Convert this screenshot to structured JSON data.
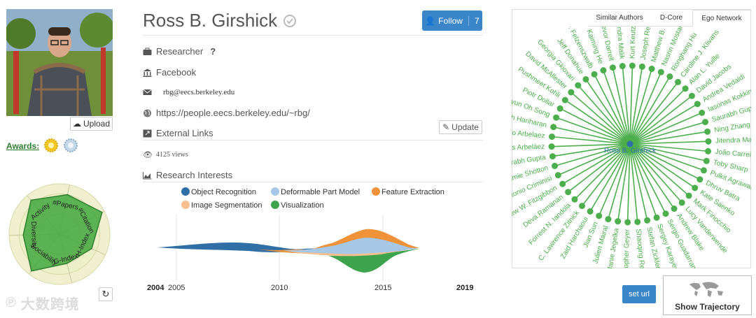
{
  "profile": {
    "name": "Ross B. Girshick",
    "upload_label": "Upload",
    "awards_label": "Awards:",
    "follow_label": "Follow",
    "follow_count": "7",
    "position": "Researcher",
    "position_help": "?",
    "affiliation": "Facebook",
    "email": "rbg@eecs.berkeley.edu",
    "homepage": "https://people.eecs.berkeley.edu/~rbg/",
    "external_links_label": "External Links",
    "update_label": "Update",
    "views": "4125 views",
    "research_interests_label": "Research Interests"
  },
  "radar": {
    "axes": [
      "#Papers",
      "#Citation",
      "H-Index",
      "G-Index",
      "Sociability",
      "Diversity",
      "Activity"
    ],
    "values": [
      0.8,
      0.95,
      0.7,
      0.6,
      0.92,
      0.72,
      0.88
    ],
    "fill": "#43a83e"
  },
  "interests_chart": {
    "legend": [
      {
        "name": "Object Recognition",
        "color": "#2f6fa6"
      },
      {
        "name": "Deformable Part Model",
        "color": "#a7c7e7"
      },
      {
        "name": "Feature Extraction",
        "color": "#f0923a"
      },
      {
        "name": "Image Segmentation",
        "color": "#f7c08f"
      },
      {
        "name": "Visualization",
        "color": "#3da44d"
      }
    ],
    "x_start_label": "2004",
    "x_end_label": "2019",
    "ticks": [
      "2005",
      "2010",
      "2015"
    ]
  },
  "tabs": [
    "Similar Authors",
    "D-Core",
    "Ego Network"
  ],
  "active_tab": "Ego Network",
  "ego_network": {
    "center": "Ross B. Girshick",
    "color": "#4cae4c",
    "nodes": [
      "Kurt Keutzer",
      "Joseph Redmon",
      "Matthew B. Blaschko",
      "Nasrin Mostafazadeh",
      "Ronghang Hu",
      "Caroline J. Klivans",
      "Alan L. Yuille",
      "David Jacobs",
      "Andrea Vedaldi",
      "Iasonas Kokkinos",
      "Saurabh Gupta",
      "Ning Zhang",
      "Jitendra Malik",
      "João Carreira",
      "Toby Sharp",
      "Pulkit Agrawal",
      "Dhruv Batra",
      "Kate Saenko",
      "Mark Finocchio",
      "Lucy Vanderwende",
      "Andrew Blake",
      "Sergio Guadarrama",
      "Sergey Karayev",
      "Stefan Zickler",
      "Shaoqing Ren",
      "Christopher Geyer",
      "Stefanie Jegelka",
      "Julien Mairal",
      "Jian Sun",
      "Zaid Harchaoui",
      "C. Lawrence Zitnick",
      "Forrest N. Iandola",
      "Deva Ramanan",
      "Andrew W. Fitzgibbon",
      "Antonio Criminisi",
      "Jamie Shotton",
      "Saurabh Gupta",
      "Andrés Arbeláez",
      "Pablo Arbelaez",
      "Bharath Hariharan",
      "Hyun Oh Song",
      "Piotr Dollar",
      "Pushmeet Kohli",
      "David McAllester",
      "Georgia Gkioxari",
      "Jeff Donahue",
      "Pedro F. Felzenszwalb",
      "Kaiming He",
      "Trevor Darrell",
      "Jitendra Malik"
    ]
  },
  "buttons": {
    "set_url": "set url",
    "show_trajectory": "Show Trajectory"
  },
  "watermark": "大数跨境"
}
